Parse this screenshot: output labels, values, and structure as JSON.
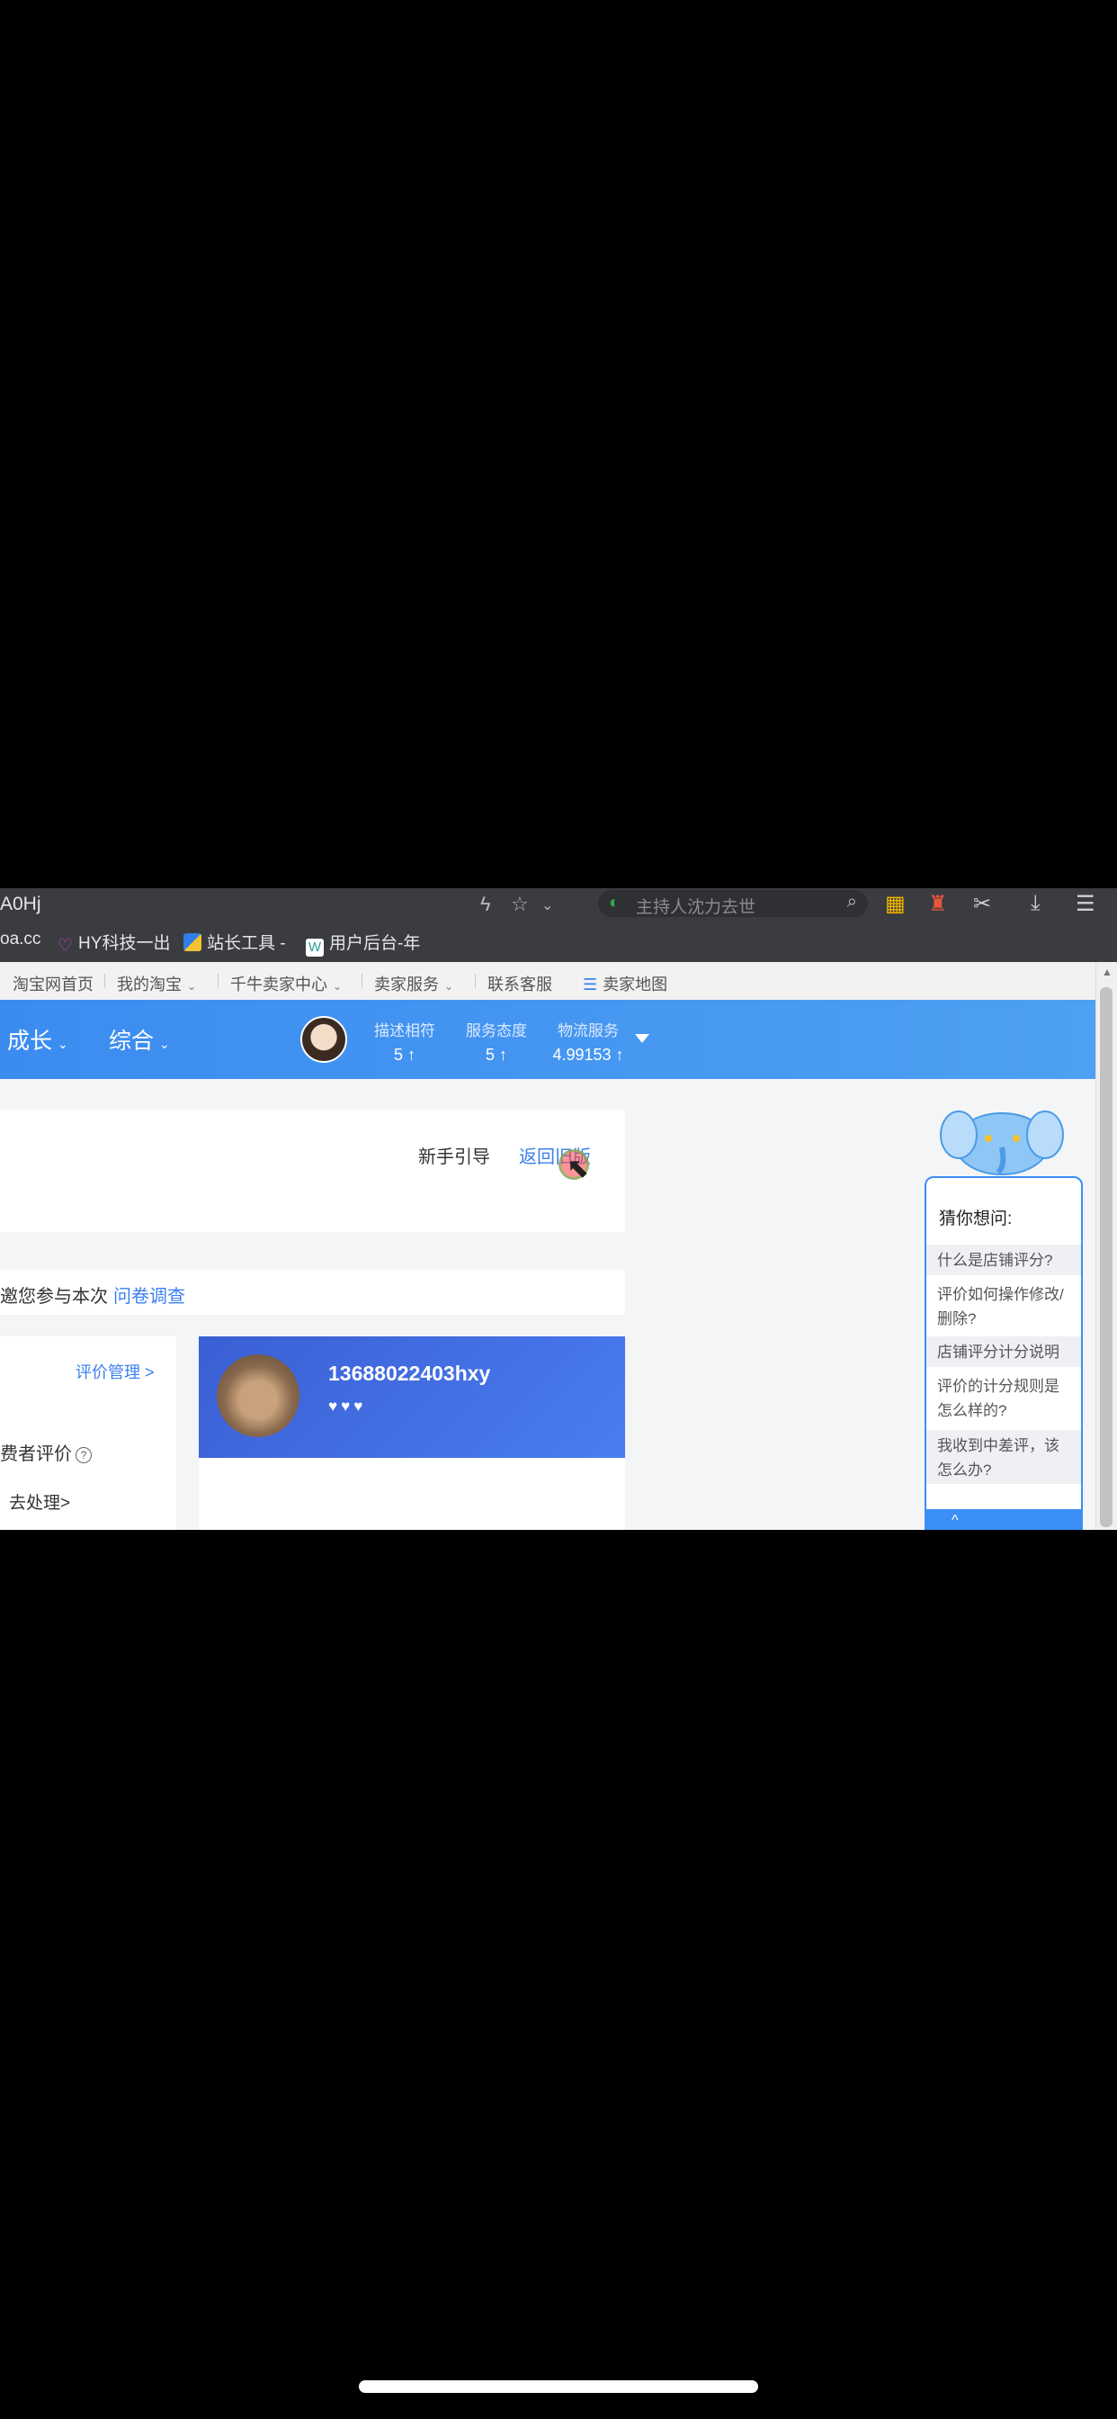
{
  "browser": {
    "url": "A0Hj",
    "search_placeholder": "主持人沈力去世",
    "bookmarks": [
      {
        "label": "oa.cc"
      },
      {
        "label": "HY科技一出"
      },
      {
        "label": "站长工具 -"
      },
      {
        "label": "用户后台-年"
      }
    ]
  },
  "site_nav": {
    "items": [
      {
        "label": "淘宝网首页"
      },
      {
        "label": "我的淘宝"
      },
      {
        "label": "千牛卖家中心"
      },
      {
        "label": "卖家服务"
      },
      {
        "label": "联系客服"
      },
      {
        "label": "卖家地图"
      }
    ]
  },
  "header": {
    "menus": [
      {
        "label": "成长"
      },
      {
        "label": "综合"
      }
    ],
    "scores": [
      {
        "label": "描述相符",
        "value": "5 ↑"
      },
      {
        "label": "服务态度",
        "value": "5 ↑"
      },
      {
        "label": "物流服务",
        "value": "4.99153 ↑"
      }
    ]
  },
  "top_card": {
    "guide": "新手引导",
    "return": "返回旧版"
  },
  "survey": {
    "text": "邀您参与本次",
    "link": "问卷调查"
  },
  "left_card": {
    "review_mgmt": "评价管理 >",
    "buyer_review": "费者评价",
    "help_mark": "?",
    "goto": "去处理>"
  },
  "profile": {
    "name": "13688022403hxy",
    "hearts": "♥♥♥"
  },
  "help_widget": {
    "title": "猜你想问:",
    "questions": [
      {
        "text": "什么是店铺评分?"
      },
      {
        "text": "评价如何操作修改/删除?"
      },
      {
        "text": "店铺评分计分说明"
      },
      {
        "text": "评价的计分规则是怎么样的?"
      },
      {
        "text": "我收到中差评，该怎么办?"
      }
    ],
    "footer": "^"
  }
}
